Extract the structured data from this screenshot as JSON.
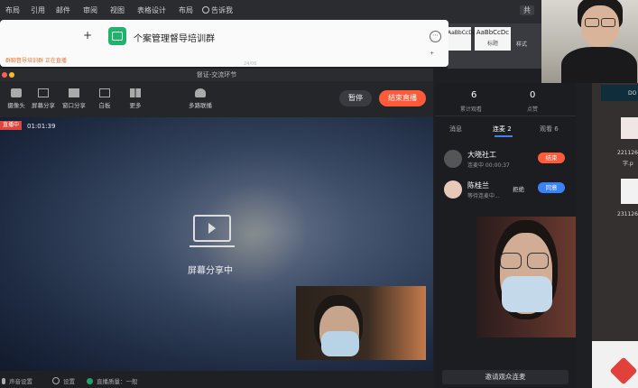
{
  "word_menu": [
    "布局",
    "引用",
    "邮件",
    "审阅",
    "视图",
    "表格设计",
    "布局",
    "告诉我"
  ],
  "word_share_label": "共",
  "word_styles": [
    "AaBbCcDc",
    "AaBbCcDc"
  ],
  "word_style_names": [
    "",
    "标题"
  ],
  "word_style_pane": "样式",
  "chat_popup": {
    "group_title": "个案管理督导培训群",
    "snippet": "群聊督导培训群 正在直播",
    "count": "24/06"
  },
  "window_title": "督证-交流环节",
  "toolbar": {
    "items": [
      "摄像头",
      "屏幕分享",
      "窗口分享",
      "白板",
      "更多",
      "多路联播"
    ],
    "pause_label": "暂停",
    "end_label": "结束直播"
  },
  "live_badge": "直播中",
  "live_timer": "01:01:39",
  "screen_share_text": "屏幕分享中",
  "statusbar": {
    "audio": "声音设置",
    "settings": "设置",
    "network": "直播质量：一般"
  },
  "panel": {
    "stats": [
      {
        "value": "6",
        "label": "累计观看"
      },
      {
        "value": "0",
        "label": "点赞"
      }
    ],
    "tabs": [
      "消息",
      "连麦 2",
      "观看 6"
    ],
    "users": [
      {
        "name": "大晓社工",
        "status": "连麦中 00:00:37",
        "action1": "",
        "action2": "结束"
      },
      {
        "name": "陈桂兰",
        "status": "等待连麦中...",
        "action1": "拒绝",
        "action2": "同意"
      }
    ],
    "invite_label": "邀请观众连麦"
  },
  "desktop_files": [
    {
      "name": "DO"
    },
    {
      "name": "221126",
      "sub": "字.p"
    },
    {
      "name": "231126"
    }
  ],
  "colors": {
    "accent": "#ff5a3a",
    "blue": "#3b82f6",
    "green": "#22a06b"
  }
}
